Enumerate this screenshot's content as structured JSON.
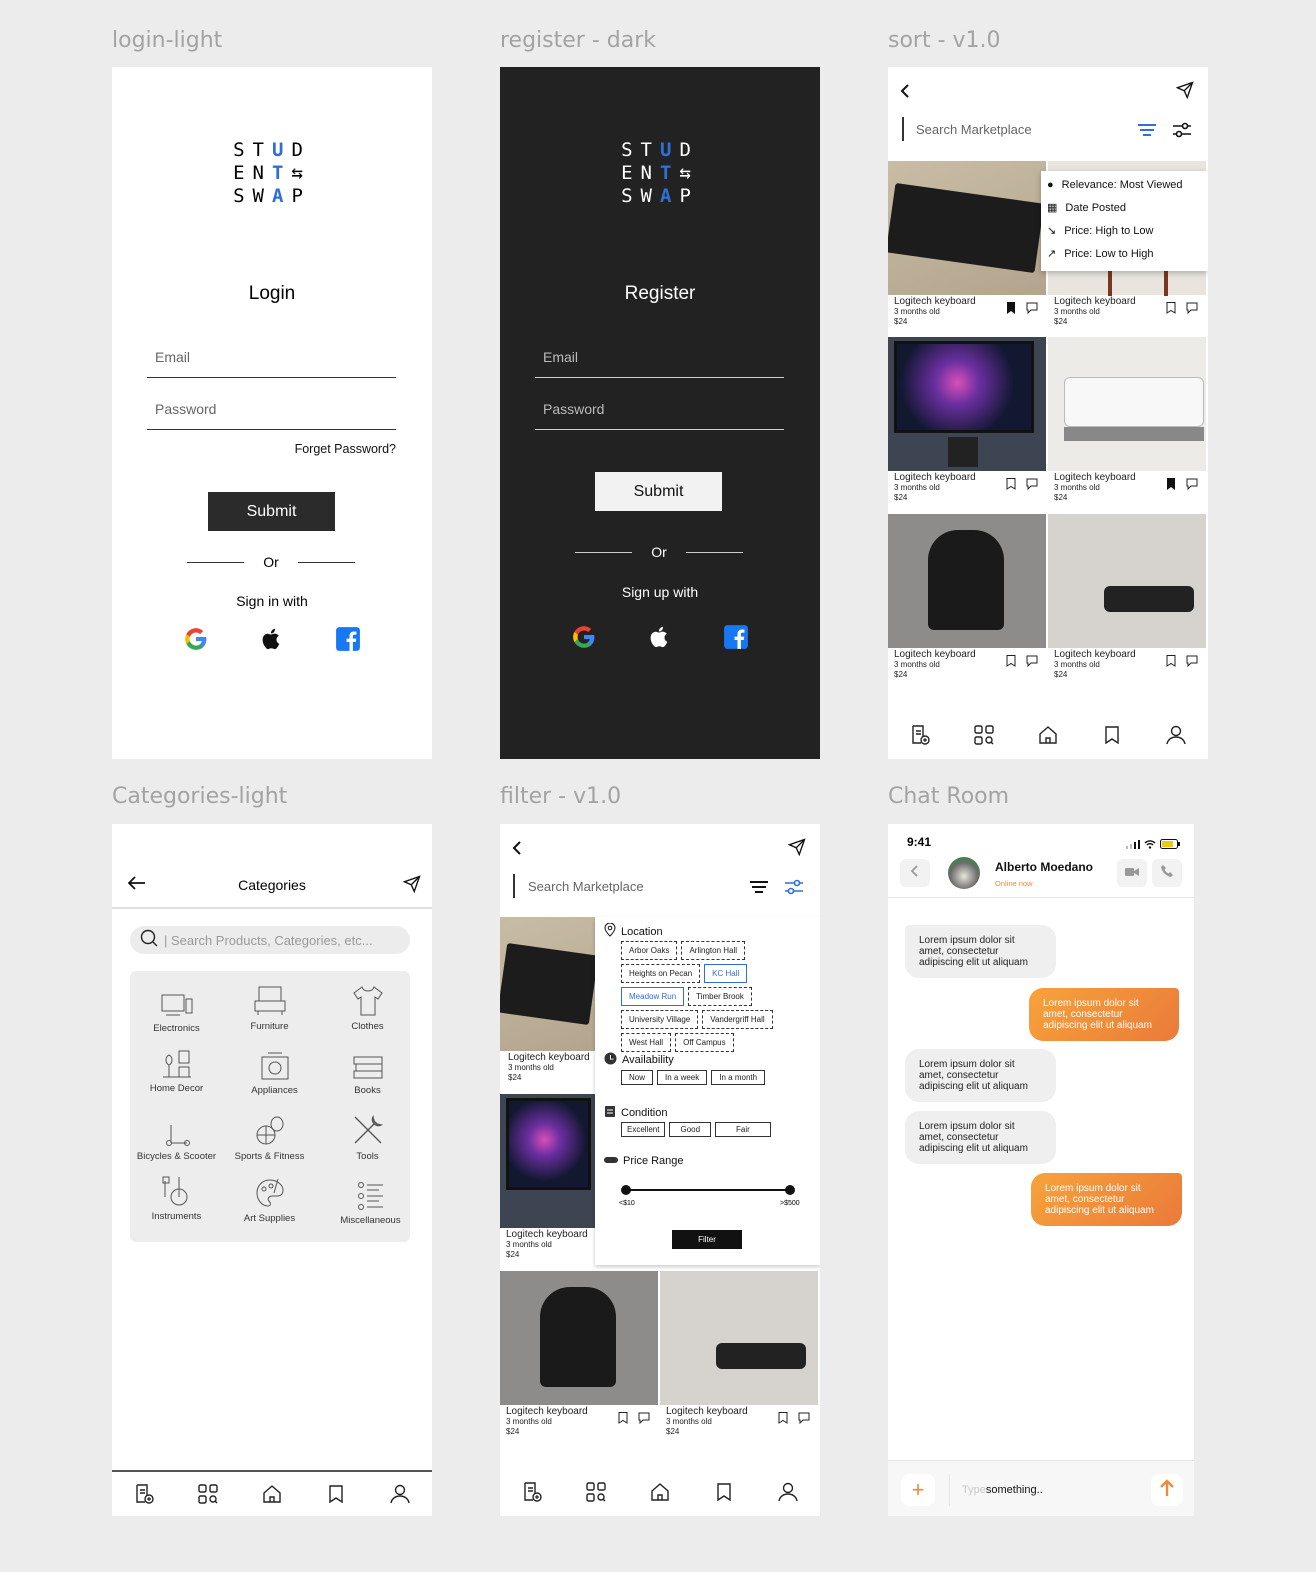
{
  "frames": {
    "login": {
      "label": "login-light",
      "logo": [
        "STU",
        "D",
        "ENT",
        "SWA",
        "P"
      ],
      "title": "Login",
      "email": "Email",
      "password": "Password",
      "forgot": "Forget Password?",
      "submit": "Submit",
      "or": "Or",
      "signin": "Sign in with"
    },
    "register": {
      "label": "register - dark",
      "title": "Register",
      "email": "Email",
      "password": "Password",
      "submit": "Submit",
      "or": "Or",
      "signup": "Sign up with"
    },
    "sort": {
      "label": "sort - v1.0",
      "search": "Search Marketplace",
      "options": [
        "Relevance: Most Viewed",
        "Date Posted",
        "Price: High to Low",
        "Price: Low to High"
      ]
    },
    "categories": {
      "label": "Categories-light",
      "title": "Categories",
      "search": "| Search Products, Categories, etc...",
      "items": [
        "Electronics",
        "Furniture",
        "Clothes",
        "Home Decor",
        "Appliances",
        "Books",
        "Bicycles & Scooter",
        "Sports & Fitness",
        "Tools",
        "Instruments",
        "Art Supplies",
        "Miscellaneous"
      ]
    },
    "filter": {
      "label": "filter - v1.0",
      "search": "Search Marketplace",
      "location_title": "Location",
      "locations": [
        "Arbor Oaks",
        "Arlington Hall",
        "Heights on Pecan",
        "KC Hall",
        "Meadow Run",
        "Timber Brook",
        "University Village",
        "Vandergriff Hall",
        "West Hall",
        "Off Campus"
      ],
      "availability_title": "Availability",
      "availability": [
        "Now",
        "In a week",
        "In a month"
      ],
      "condition_title": "Condition",
      "conditions": [
        "Excellent",
        "Good",
        "Fair"
      ],
      "price_title": "Price Range",
      "price_min": "<$10",
      "price_max": ">$500",
      "filter_btn": "Filter"
    },
    "chat": {
      "label": "Chat Room",
      "time": "9:41",
      "name": "Alberto Moedano",
      "status": "Online now",
      "messages": [
        "Lorem ipsum dolor sit amet, consectetur adipiscing elit ut aliquam",
        "Lorem ipsum dolor sit amet, consectetur adipiscing elit ut aliquam",
        "Lorem ipsum dolor sit amet, consectetur adipiscing elit ut aliquam",
        "Lorem ipsum dolor sit amet, consectetur adipiscing elit ut aliquam",
        "Lorem ipsum dolor sit amet, consectetur adipiscing elit ut aliquam"
      ],
      "type_prefix": "Type",
      "type_rest": " something.."
    }
  },
  "listing": {
    "name": "Logitech keyboard",
    "age": "3 months old",
    "price": "$24"
  },
  "colors": {
    "accent": "#2f6fd6",
    "orange": "#ef8a3a",
    "dark_bg": "#222222",
    "canvas": "#ececec"
  }
}
